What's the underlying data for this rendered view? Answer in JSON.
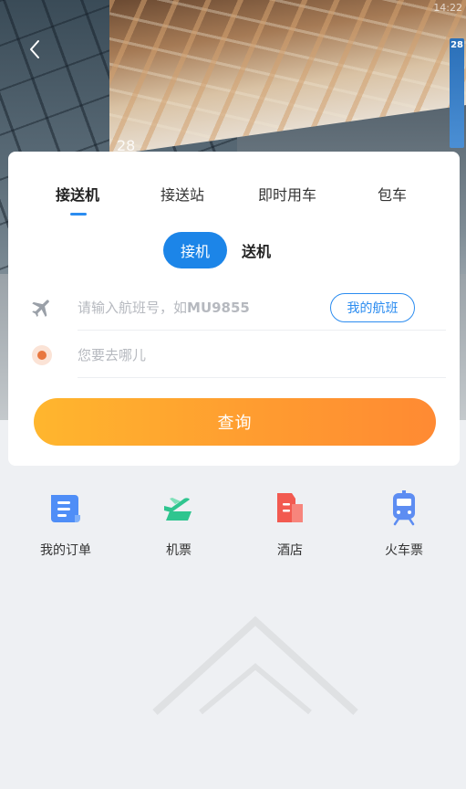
{
  "status_bar": {
    "time": "14:22"
  },
  "hero": {
    "gate_number": "28",
    "board_number": "28"
  },
  "tabs": [
    {
      "label": "接送机",
      "active": true
    },
    {
      "label": "接送站",
      "active": false
    },
    {
      "label": "即时用车",
      "active": false
    },
    {
      "label": "包车",
      "active": false
    }
  ],
  "mode_toggle": {
    "pickup_label": "接机",
    "dropoff_label": "送机",
    "selected": "接机"
  },
  "flight_input": {
    "placeholder_prefix": "请输入航班号，如",
    "placeholder_example": "MU9855",
    "my_flights_label": "我的航班"
  },
  "destination_input": {
    "placeholder": "您要去哪儿"
  },
  "query_button": {
    "label": "查询"
  },
  "services": [
    {
      "label": "我的订单",
      "icon": "order-scroll-icon",
      "color": "#4f8ef7"
    },
    {
      "label": "机票",
      "icon": "airplane-ticket-icon",
      "color": "#2fc58f"
    },
    {
      "label": "酒店",
      "icon": "hotel-building-icon",
      "color": "#f25a50"
    },
    {
      "label": "火车票",
      "icon": "train-icon",
      "color": "#5d8df2"
    }
  ],
  "colors": {
    "accent_blue": "#2b8cf0",
    "query_gradient_start": "#ffb62e",
    "query_gradient_end": "#ff8a33"
  }
}
